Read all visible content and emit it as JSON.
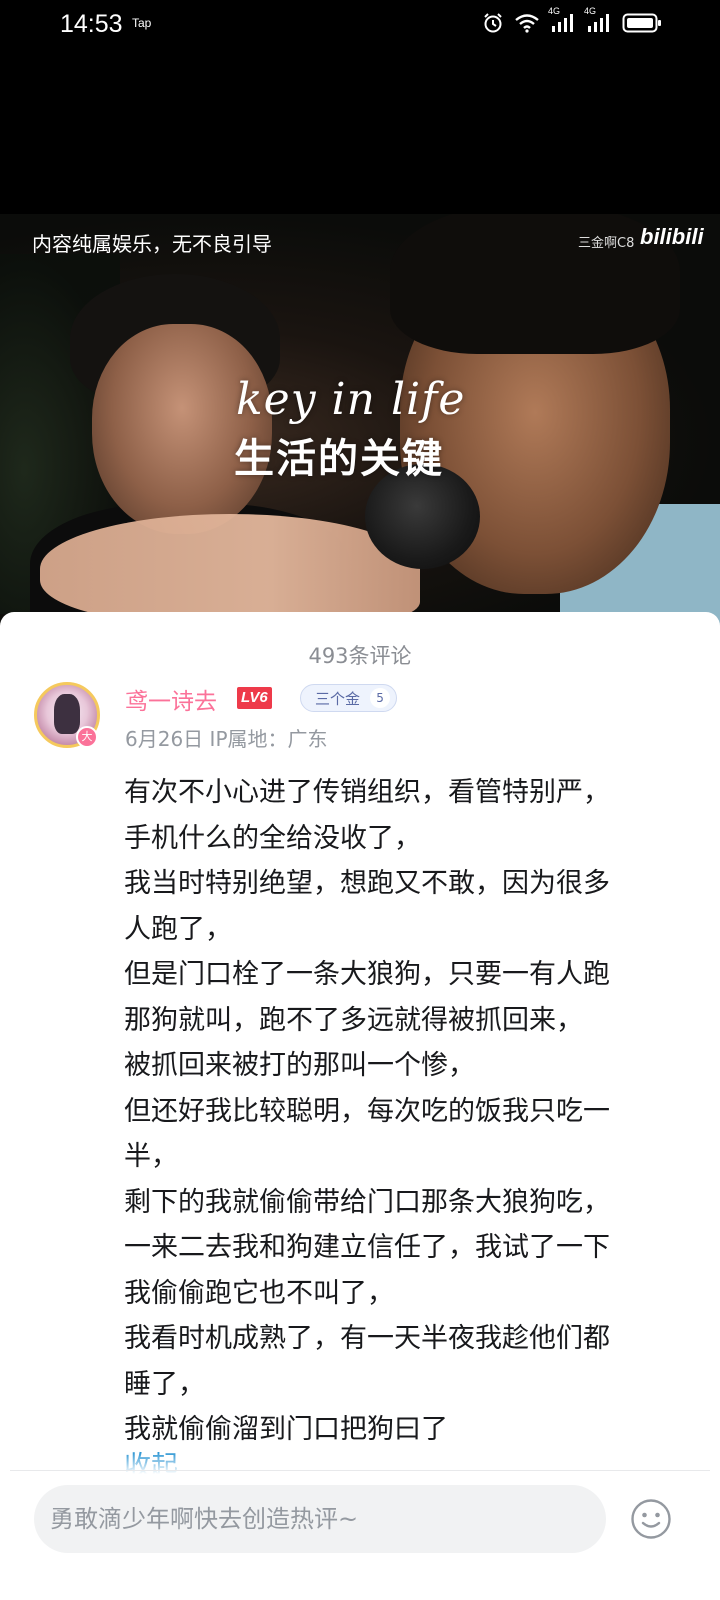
{
  "status_bar": {
    "time": "14:53",
    "tag": "Tap",
    "icons": [
      "alarm-icon",
      "wifi-icon",
      "signal-4g-icon",
      "signal-4g-icon",
      "battery-icon"
    ],
    "signal_label": "4G"
  },
  "video": {
    "disclaimer": "内容纯属娱乐，无不良引导",
    "uploader": "三金啊C8",
    "logo": "bilibili",
    "title_en": "key in life",
    "title_zh": "生活的关键"
  },
  "comments": {
    "count_label": "493条评论",
    "comment": {
      "user": "鸢一诗去",
      "level": "LV6",
      "fan_medal": {
        "name": "三个金",
        "level": "5"
      },
      "avatar_badge": "大",
      "date": "6月26日",
      "ip_label": "IP属地：广东",
      "lines": [
        "有次不小心进了传销组织，看管特别严，",
        "手机什么的全给没收了，",
        "我当时特别绝望，想跑又不敢，因为很多",
        "人跑了，",
        "但是门口栓了一条大狼狗，只要一有人跑",
        "那狗就叫，跑不了多远就得被抓回来，",
        "被抓回来被打的那叫一个惨，",
        "但还好我比较聪明，每次吃的饭我只吃一",
        "半，",
        "剩下的我就偷偷带给门口那条大狼狗吃，",
        "一来二去我和狗建立信任了，我试了一下",
        "我偷偷跑它也不叫了，",
        "我看时机成熟了，有一天半夜我趁他们都",
        "睡了，",
        "我就偷偷溜到门口把狗曰了"
      ],
      "collapse_label": "收起"
    },
    "reply_placeholder": "勇敢滴少年啊快去创造热评~"
  },
  "colors": {
    "accent_pink": "#fb7299",
    "link_blue": "#178bcf",
    "level_red": "#ee3a4a"
  }
}
